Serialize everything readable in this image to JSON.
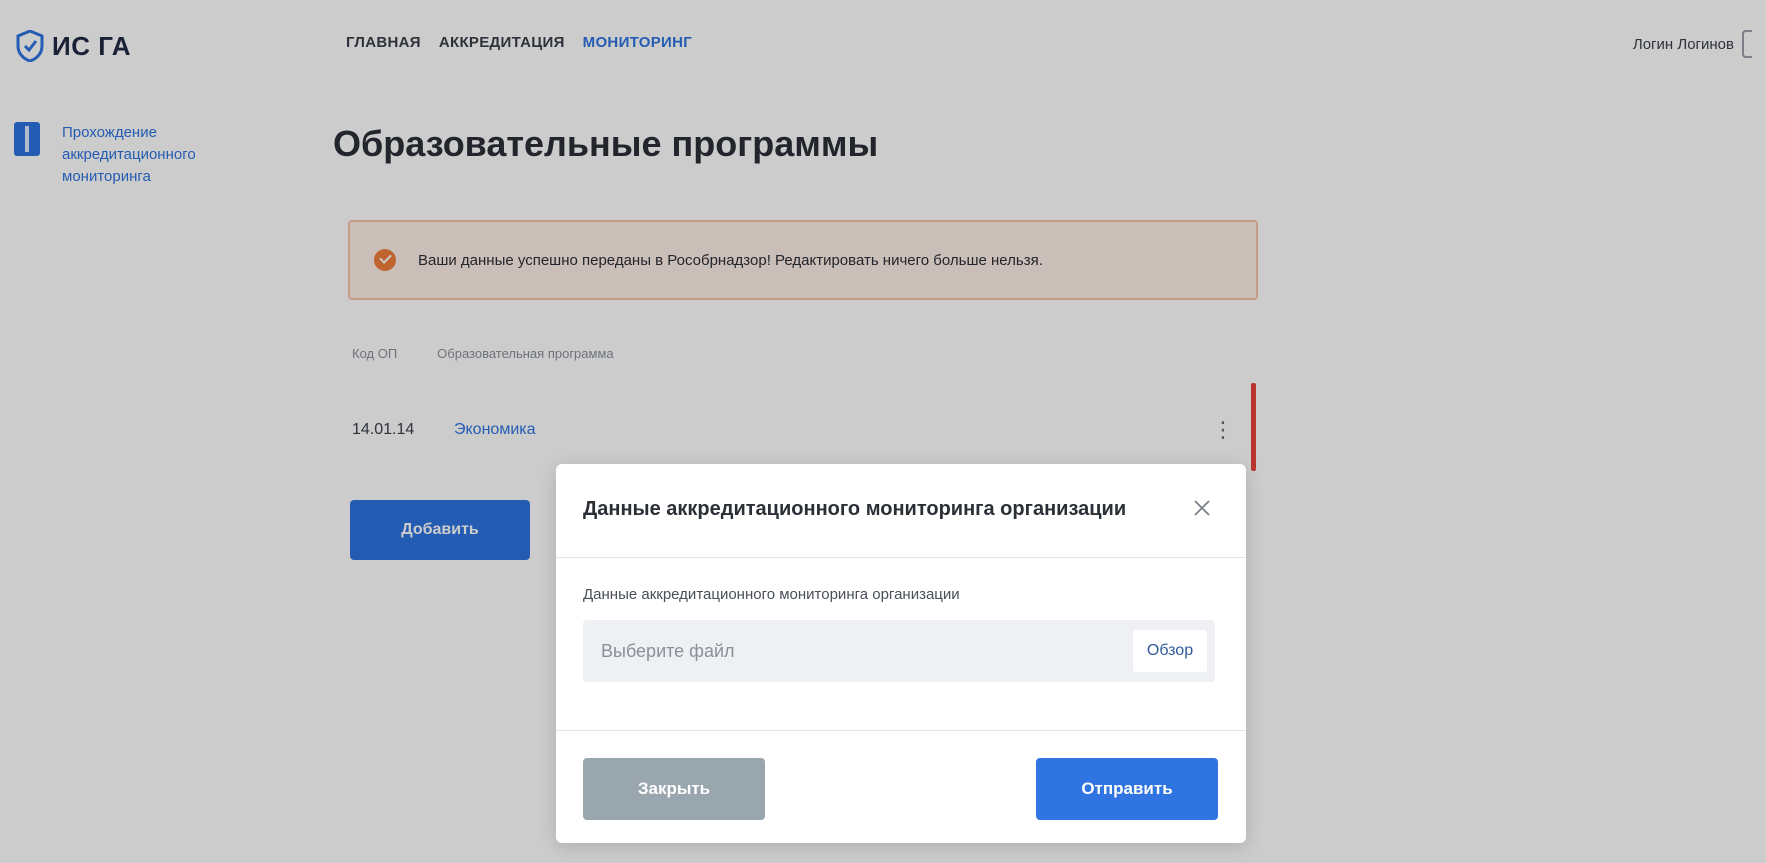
{
  "header": {
    "logo_text": "ИС ГА",
    "nav": [
      "ГЛАВНАЯ",
      "АККРЕДИТАЦИЯ",
      "МОНИТОРИНГ"
    ],
    "active_nav": "МОНИТОРИНГ",
    "user_name": "Логин Логинов"
  },
  "sidebar": {
    "items": [
      {
        "label": "Прохождение аккредитационного мониторинга",
        "icon": "book-icon"
      }
    ]
  },
  "main": {
    "title": "Образовательные программы",
    "alert": {
      "icon": "check-circle-icon",
      "text": "Ваши данные успешно переданы в Рособрнадзор! Редактировать ничего больше нельзя."
    },
    "table": {
      "columns": [
        "Код ОП",
        "Образовательная программа"
      ],
      "rows": [
        {
          "code": "14.01.14",
          "name": "Экономика",
          "menu": "⋮"
        }
      ]
    },
    "add_button": "Добавить"
  },
  "modal": {
    "title": "Данные аккредитационного мониторинга организации",
    "field_label": "Данные аккредитационного мониторинга организации",
    "file_placeholder": "Выберите файл",
    "browse_label": "Обзор",
    "close_label": "Закрыть",
    "send_label": "Отправить"
  },
  "colors": {
    "accent": "#2f74e0",
    "alert_bg": "#fdeee6",
    "alert_border": "#f6c2a8",
    "alert_icon": "#ef7d3b",
    "row_marker": "#e8443a",
    "close_button": "#9aa6ad"
  }
}
